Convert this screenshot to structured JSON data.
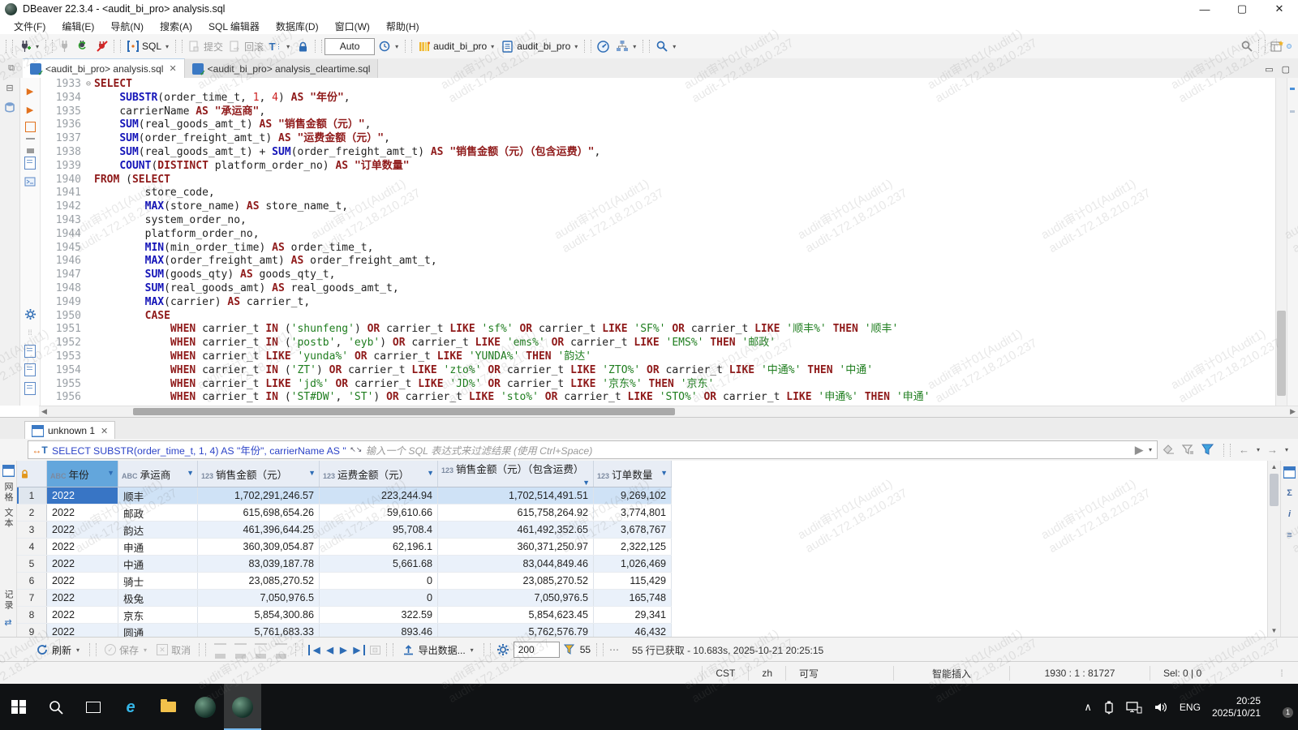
{
  "window": {
    "title": "DBeaver 22.3.4 - <audit_bi_pro> analysis.sql"
  },
  "menu": [
    "文件(F)",
    "编辑(E)",
    "导航(N)",
    "搜索(A)",
    "SQL 编辑器",
    "数据库(D)",
    "窗口(W)",
    "帮助(H)"
  ],
  "toolbar": {
    "sql_button": "SQL",
    "commit": "提交",
    "rollback": "回滚",
    "tx_mode": "Auto",
    "connection": "audit_bi_pro",
    "schema": "audit_bi_pro"
  },
  "editor_tabs": {
    "tab1": "<audit_bi_pro> analysis.sql",
    "tab2": "<audit_bi_pro> analysis_cleartime.sql"
  },
  "code": {
    "keywords": [
      "SELECT",
      "AS",
      "FROM",
      "DISTINCT",
      "CASE",
      "WHEN",
      "IN",
      "OR",
      "LIKE",
      "THEN"
    ],
    "functions": [
      "SUBSTR",
      "SUM",
      "COUNT",
      "MAX",
      "MIN"
    ],
    "lines": [
      {
        "no": "1933",
        "fold": true,
        "text": "SELECT"
      },
      {
        "no": "1934",
        "text": "    SUBSTR(order_time_t, 1, 4) AS \"年份\","
      },
      {
        "no": "1935",
        "text": "    carrierName AS \"承运商\","
      },
      {
        "no": "1936",
        "text": "    SUM(real_goods_amt_t) AS \"销售金额（元）\","
      },
      {
        "no": "1937",
        "text": "    SUM(order_freight_amt_t) AS \"运费金额（元）\","
      },
      {
        "no": "1938",
        "text": "    SUM(real_goods_amt_t) + SUM(order_freight_amt_t) AS \"销售金额（元）（包含运费）\","
      },
      {
        "no": "1939",
        "text": "    COUNT(DISTINCT platform_order_no) AS \"订单数量\""
      },
      {
        "no": "1940",
        "text": "FROM (SELECT"
      },
      {
        "no": "1941",
        "text": "        store_code,"
      },
      {
        "no": "1942",
        "text": "        MAX(store_name) AS store_name_t,"
      },
      {
        "no": "1943",
        "text": "        system_order_no,"
      },
      {
        "no": "1944",
        "text": "        platform_order_no,"
      },
      {
        "no": "1945",
        "text": "        MIN(min_order_time) AS order_time_t,"
      },
      {
        "no": "1946",
        "text": "        MAX(order_freight_amt) AS order_freight_amt_t,"
      },
      {
        "no": "1947",
        "text": "        SUM(goods_qty) AS goods_qty_t,"
      },
      {
        "no": "1948",
        "text": "        SUM(real_goods_amt) AS real_goods_amt_t,"
      },
      {
        "no": "1949",
        "text": "        MAX(carrier) AS carrier_t,"
      },
      {
        "no": "1950",
        "text": "        CASE"
      },
      {
        "no": "1951",
        "text": "            WHEN carrier_t IN ('shunfeng') OR carrier_t LIKE 'sf%' OR carrier_t LIKE 'SF%' OR carrier_t LIKE '顺丰%' THEN '顺丰'"
      },
      {
        "no": "1952",
        "text": "            WHEN carrier_t IN ('postb', 'eyb') OR carrier_t LIKE 'ems%' OR carrier_t LIKE 'EMS%' THEN '邮政'"
      },
      {
        "no": "1953",
        "text": "            WHEN carrier_t LIKE 'yunda%' OR carrier_t LIKE 'YUNDA%' THEN '韵达'"
      },
      {
        "no": "1954",
        "text": "            WHEN carrier_t IN ('ZT') OR carrier_t LIKE 'zto%' OR carrier_t LIKE 'ZTO%' OR carrier_t LIKE '中通%' THEN '中通'"
      },
      {
        "no": "1955",
        "text": "            WHEN carrier_t LIKE 'jd%' OR carrier_t LIKE 'JD%' OR carrier_t LIKE '京东%' THEN '京东'"
      },
      {
        "no": "1956",
        "text": "            WHEN carrier_t IN ('ST#DW', 'ST') OR carrier_t LIKE 'sto%' OR carrier_t LIKE 'STO%' OR carrier_t LIKE '申通%' THEN '申通'"
      }
    ]
  },
  "results": {
    "tab": "unknown 1",
    "filter": {
      "query_preview": "SELECT SUBSTR(order_time_t, 1, 4) AS \"年份\", carrierName AS \"",
      "placeholder": "输入一个 SQL 表达式来过滤结果 (使用 Ctrl+Space)"
    },
    "side_tabs": {
      "grid": "网格",
      "text": "文本",
      "record": "记录"
    },
    "table": {
      "columns": [
        {
          "label": "年份",
          "type": "ABC",
          "align": "left"
        },
        {
          "label": "承运商",
          "type": "ABC",
          "align": "left"
        },
        {
          "label": "销售金额（元）",
          "type": "123",
          "align": "right"
        },
        {
          "label": "运费金额（元）",
          "type": "123",
          "align": "right"
        },
        {
          "label": "销售金额（元）（包含运费）",
          "type": "123",
          "align": "right"
        },
        {
          "label": "订单数量",
          "type": "123",
          "align": "right"
        }
      ],
      "rows": [
        [
          "2022",
          "顺丰",
          "1,702,291,246.57",
          "223,244.94",
          "1,702,514,491.51",
          "9,269,102"
        ],
        [
          "2022",
          "邮政",
          "615,698,654.26",
          "59,610.66",
          "615,758,264.92",
          "3,774,801"
        ],
        [
          "2022",
          "韵达",
          "461,396,644.25",
          "95,708.4",
          "461,492,352.65",
          "3,678,767"
        ],
        [
          "2022",
          "申通",
          "360,309,054.87",
          "62,196.1",
          "360,371,250.97",
          "2,322,125"
        ],
        [
          "2022",
          "中通",
          "83,039,187.78",
          "5,661.68",
          "83,044,849.46",
          "1,026,469"
        ],
        [
          "2022",
          "骑士",
          "23,085,270.52",
          "0",
          "23,085,270.52",
          "115,429"
        ],
        [
          "2022",
          "极兔",
          "7,050,976.5",
          "0",
          "7,050,976.5",
          "165,748"
        ],
        [
          "2022",
          "京东",
          "5,854,300.86",
          "322.59",
          "5,854,623.45",
          "29,341"
        ],
        [
          "2022",
          "圆通",
          "5,761,683.33",
          "893.46",
          "5,762,576.79",
          "46,432"
        ]
      ],
      "selected": {
        "row": 0,
        "col": 0
      }
    },
    "footer": {
      "refresh": "刷新",
      "save": "保存",
      "cancel": "取消",
      "export": "导出数据...",
      "page_size": "200",
      "fetch_count": "55",
      "status": "55 行已获取 - 10.683s, 2025-10-21 20:25:15"
    }
  },
  "statusbar": {
    "timezone": "CST",
    "lang": "zh",
    "writable": "可写",
    "insert_mode": "智能插入",
    "position": "1930 : 1 : 81727",
    "selection": "Sel: 0 | 0"
  },
  "taskbar": {
    "lang": "ENG",
    "time": "20:25",
    "date": "2025/10/21",
    "badge": "1"
  },
  "watermark": {
    "line1": "audit审计01(Audit1)",
    "line2": "audit-172.18.210.237"
  }
}
